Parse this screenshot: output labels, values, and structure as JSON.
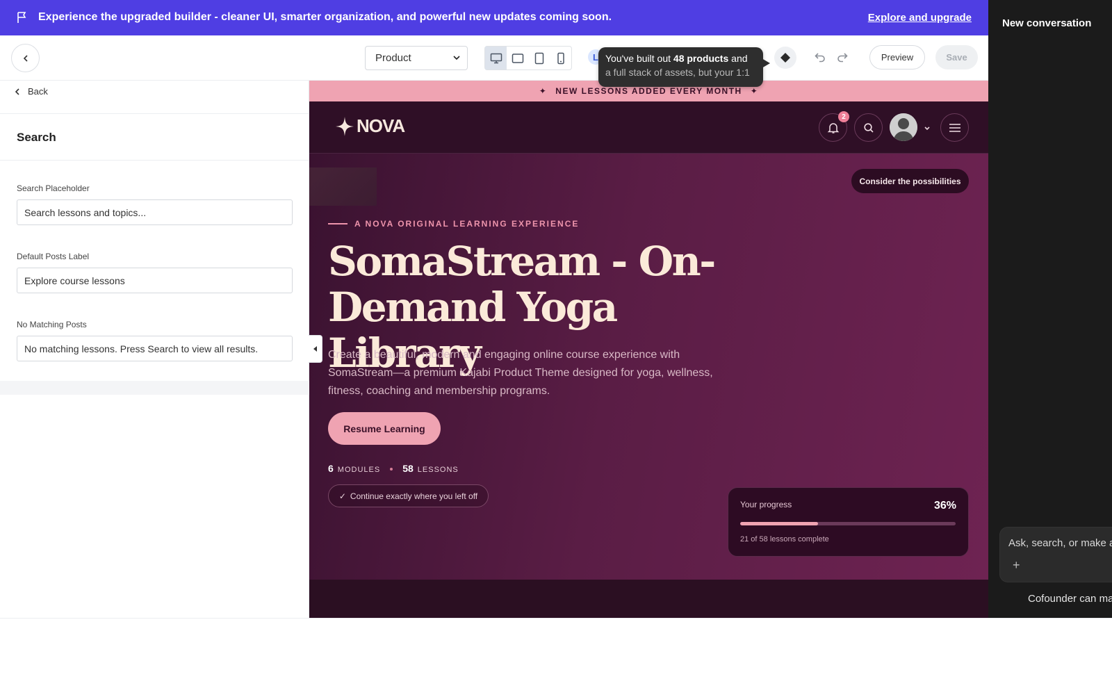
{
  "banner": {
    "message": "Experience the upgraded builder - cleaner UI, smarter organization, and powerful new updates coming soon.",
    "link": "Explore and upgrade"
  },
  "ai_panel": {
    "title": "New conversation",
    "input_placeholder": "Ask, search, or make a",
    "footer": "Cofounder can ma"
  },
  "toolbar": {
    "page_select": "Product",
    "devices": [
      "desktop",
      "tablet-landscape",
      "tablet-portrait",
      "mobile"
    ],
    "active_device": "desktop",
    "tooltip": {
      "pre": "You've built out ",
      "bold": "48 products",
      "post": " and",
      "line2": "a full stack of assets, but your 1:1"
    },
    "pill_letter": "L",
    "preview_label": "Preview",
    "save_label": "Save"
  },
  "left_panel": {
    "back_label": "Back",
    "section_title": "Search",
    "fields": [
      {
        "label": "Search Placeholder",
        "value": "Search lessons and topics..."
      },
      {
        "label": "Default Posts Label",
        "value": "Explore course lessons"
      },
      {
        "label": "No Matching Posts",
        "value": "No matching lessons. Press Search to view all results."
      }
    ]
  },
  "site": {
    "promo": "NEW LESSONS ADDED EVERY MONTH",
    "logo": "NOVA",
    "notification_count": "2",
    "consider_button": "Consider the possibilities",
    "eyebrow": "A NOVA ORIGINAL LEARNING EXPERIENCE",
    "title": "SomaStream - On-Demand Yoga Library",
    "description": "Create a beautiful, modern and engaging online course experience with SomaStream—a premium Kajabi Product Theme designed for yoga, wellness, fitness, coaching and membership programs.",
    "cta": "Resume Learning",
    "modules_count": "6",
    "modules_label": "MODULES",
    "lessons_count": "58",
    "lessons_label": "LESSONS",
    "continue_text": "Continue exactly where you left off",
    "progress": {
      "label": "Your progress",
      "percent_text": "36%",
      "fraction": 0.36,
      "sub": "21 of 58 lessons complete"
    }
  },
  "colors": {
    "banner": "#4f3ee3",
    "accent_pink": "#efa3b2",
    "hero_dark": "#2b0f22",
    "hero_title": "#fbead9"
  }
}
